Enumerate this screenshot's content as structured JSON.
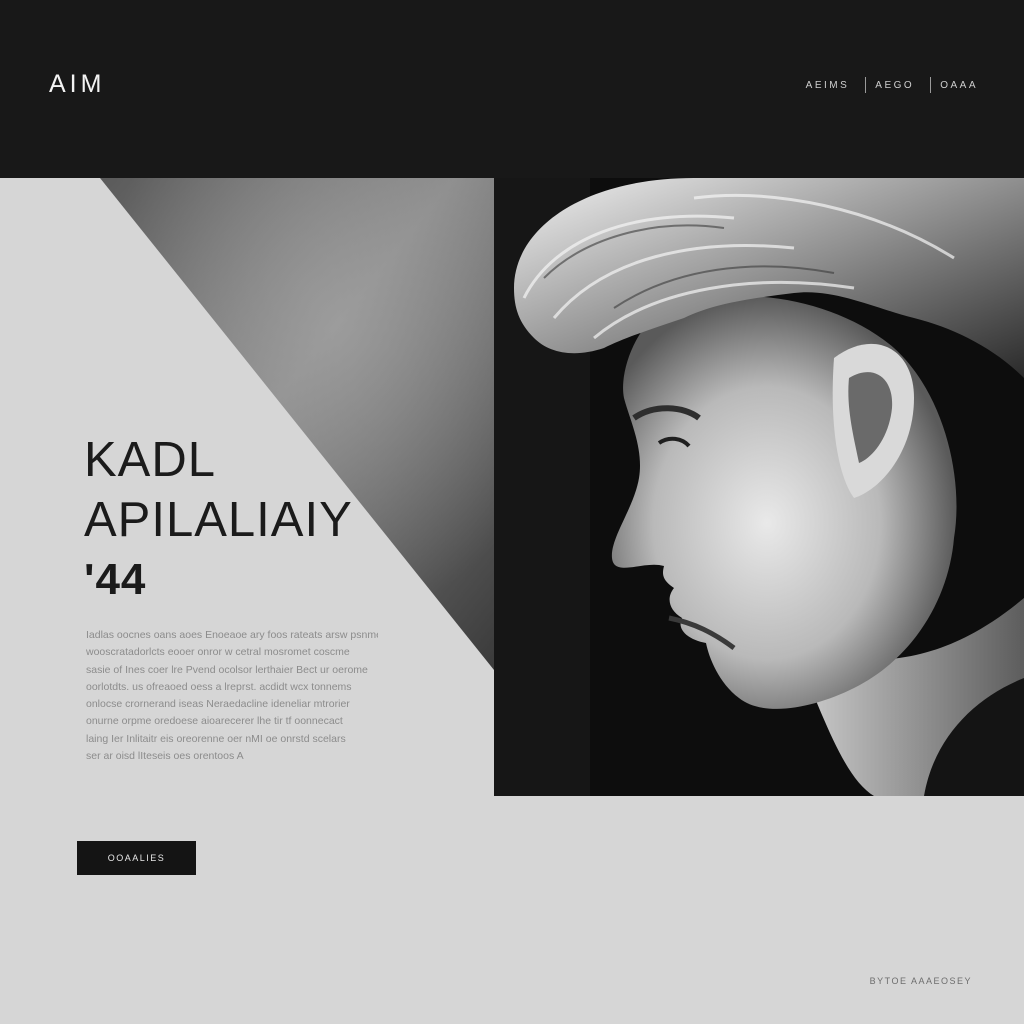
{
  "header": {
    "logo": "AIM",
    "nav": [
      {
        "label": "AEIMS"
      },
      {
        "label": "AEGO"
      },
      {
        "label": "OAAA"
      }
    ]
  },
  "hero": {
    "title_line1": "KADL",
    "title_line2": "APILALIAIY",
    "title_year": "'44",
    "body_lines": [
      "Iadlas oocnes oans aoes Enoeaoe ary foos rateats arsw psnme",
      "wooscratadorlcts eooer onror w cetral mosromet coscme",
      "sasie of Ines coer lre Pvend ocolsor lerthaier Bect ur oerome",
      "oorlotdts. us ofreaoed oess a lreprst. acdidt wcx tonnems",
      "onlocse crornerand iseas Neraedacline ideneliar mtrorier",
      "onurne orpme oredoese aioarecerer lhe tir tf oonnecact",
      "laing Ier Inlitaitr eis oreorenne oer nMI oe onrstd scelars",
      "ser ar oisd lIteseis oes orentoos A"
    ],
    "cta_label": "OOAALIES"
  },
  "footer": {
    "note": "BYTOE AAAEOSEY"
  },
  "colors": {
    "header_bg": "#181818",
    "page_bg": "#d6d6d6",
    "cta_bg": "#141414"
  }
}
